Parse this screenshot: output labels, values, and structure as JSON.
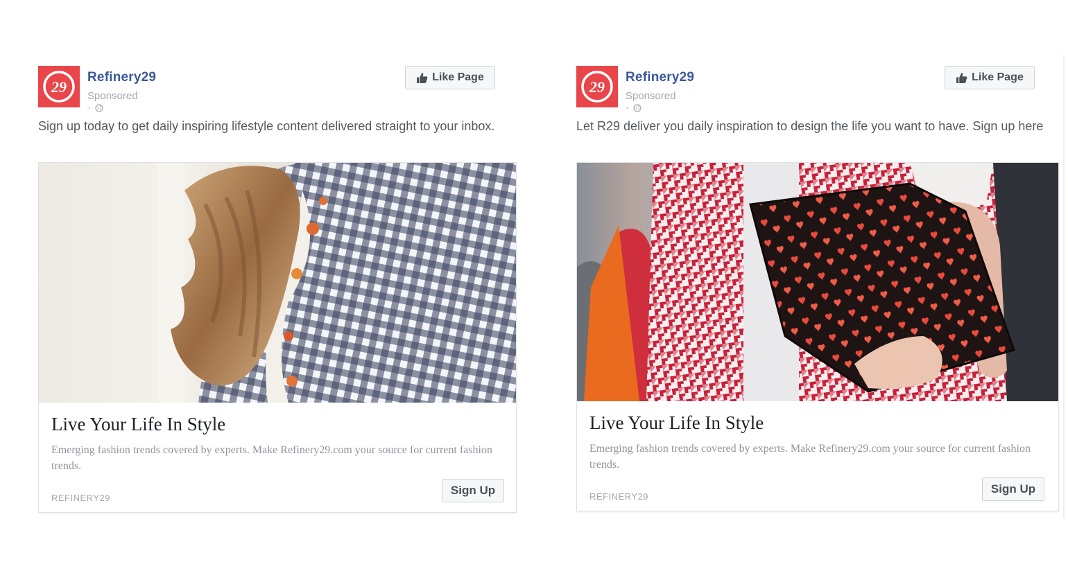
{
  "ads": [
    {
      "page_name": "Refinery29",
      "sponsored": "Sponsored",
      "separator": "·",
      "like_label": "Like Page",
      "post_text": "Sign up today to get daily inspiring lifestyle content delivered straight to your inbox.",
      "headline": "Live Your Life In Style",
      "description": "Emerging fashion trends covered by experts. Make Refinery29.com your source for current fashion trends.",
      "domain": "REFINERY29",
      "cta_label": "Sign Up",
      "logo_text": "29",
      "image_icon": "woman-hair-gingham-photo"
    },
    {
      "page_name": "Refinery29",
      "sponsored": "Sponsored",
      "separator": "·",
      "like_label": "Like Page",
      "post_text": "Let R29 deliver you daily inspiration to design the life you want to have. Sign up here",
      "headline": "Live Your Life In Style",
      "description": "Emerging fashion trends covered by experts. Make Refinery29.com your source for current fashion trends.",
      "domain": "REFINERY29",
      "cta_label": "Sign Up",
      "logo_text": "29",
      "image_icon": "red-houndstooth-clutch-photo"
    }
  ],
  "colors": {
    "brand_red": "#e8464a",
    "page_name_blue": "#3b5998"
  }
}
